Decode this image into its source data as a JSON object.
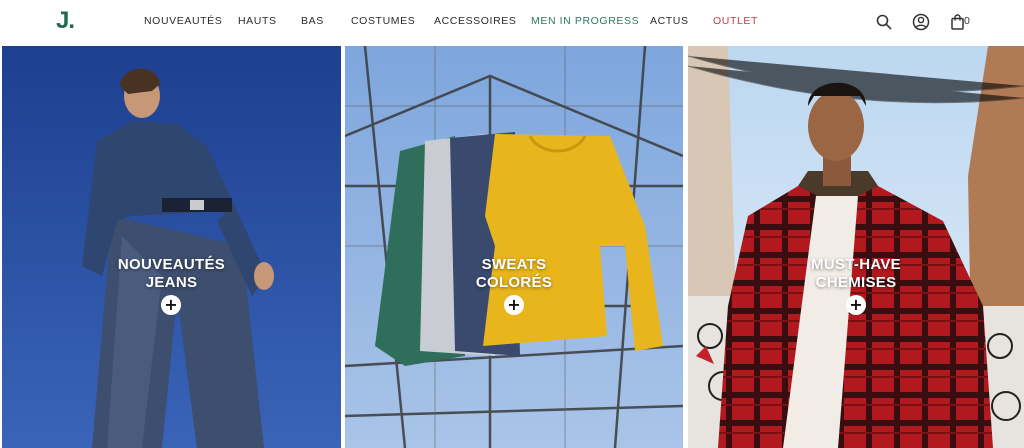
{
  "header": {
    "logo_text": "J.",
    "nav": [
      {
        "label": "NOUVEAUTÉS",
        "style": "default"
      },
      {
        "label": "HAUTS",
        "style": "default"
      },
      {
        "label": "BAS",
        "style": "default"
      },
      {
        "label": "COSTUMES",
        "style": "default"
      },
      {
        "label": "ACCESSOIRES",
        "style": "default"
      },
      {
        "label": "MEN IN PROGRESS",
        "style": "green"
      },
      {
        "label": "ACTUS",
        "style": "default"
      },
      {
        "label": "OUTLET",
        "style": "red"
      }
    ],
    "icons": {
      "search": "search-icon",
      "account": "user-icon",
      "cart": "bag-icon"
    },
    "cart_count": "0"
  },
  "tiles": [
    {
      "line1": "NOUVEAUTÉS",
      "line2": "JEANS",
      "plus": "+"
    },
    {
      "line1": "SWEATS",
      "line2": "COLORÉS",
      "plus": "+"
    },
    {
      "line1": "MUST-HAVE",
      "line2": "CHEMISES",
      "plus": "+"
    }
  ],
  "colors": {
    "brand_green": "#1f6b52",
    "nav_green": "#2f7a5d",
    "outlet_red": "#c83a4e",
    "text_dark": "#2b2b2b"
  }
}
